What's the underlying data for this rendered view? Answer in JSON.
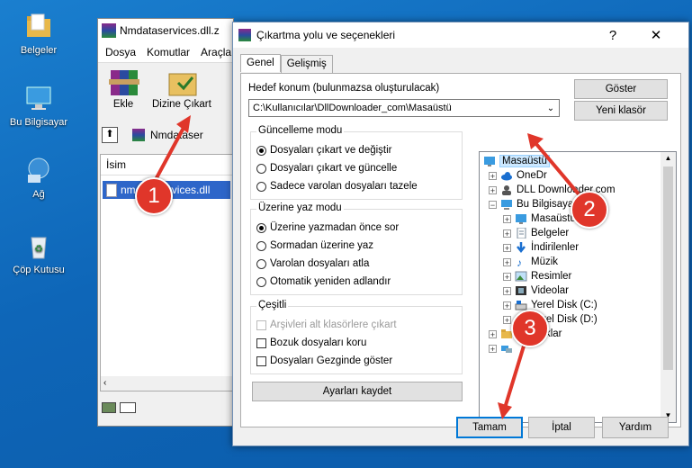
{
  "desktop": {
    "icons": [
      {
        "label": "Belgeler",
        "icon": "folder-icon"
      },
      {
        "label": "Bu Bilgisayar",
        "icon": "computer-icon"
      },
      {
        "label": "Ağ",
        "icon": "network-icon"
      },
      {
        "label": "Çöp Kutusu",
        "icon": "recycle-bin-icon"
      }
    ]
  },
  "winrar": {
    "title": "Nmdataservices.dll.z",
    "menu": [
      "Dosya",
      "Komutlar",
      "Araçla"
    ],
    "toolbar": {
      "add_label": "Ekle",
      "extract_label": "Dizine Çıkart"
    },
    "address_text": "Nmdataser",
    "column_name": "İsim",
    "selected_file": "nmdataservices.dll"
  },
  "dialog": {
    "title": "Çıkartma yolu ve seçenekleri",
    "help_glyph": "?",
    "close_glyph": "✕",
    "tabs": [
      "Genel",
      "Gelişmiş"
    ],
    "dest_label": "Hedef konum (bulunmazsa oluşturulacak)",
    "dest_value": "C:\\Kullanıcılar\\DllDownloader_com\\Masaüstü",
    "show_button": "Göster",
    "new_folder_button": "Yeni klasör",
    "update_mode": {
      "caption": "Güncelleme modu",
      "options": [
        "Dosyaları çıkart ve değiştir",
        "Dosyaları çıkart ve güncelle",
        "Sadece varolan dosyaları tazele"
      ],
      "selected": 0
    },
    "overwrite_mode": {
      "caption": "Üzerine yaz modu",
      "options": [
        "Üzerine yazmadan önce sor",
        "Sormadan üzerine yaz",
        "Varolan dosyaları atla",
        "Otomatik yeniden adlandır"
      ],
      "selected": 0
    },
    "misc": {
      "caption": "Çeşitli",
      "options": [
        "Arşivleri alt klasörlere çıkart",
        "Bozuk dosyaları koru",
        "Dosyaları Gezginde göster"
      ]
    },
    "save_settings_button": "Ayarları kaydet",
    "tree": [
      {
        "label": "Masaüstü",
        "selected": true
      },
      {
        "label": "OneDr"
      },
      {
        "label": "DLL Downloader.com"
      },
      {
        "label": "Bu Bilgisayar"
      },
      {
        "label": "Masaüstü"
      },
      {
        "label": "Belgeler"
      },
      {
        "label": "İndirilenler"
      },
      {
        "label": "Müzik"
      },
      {
        "label": "Resimler"
      },
      {
        "label": "Videolar"
      },
      {
        "label": "Yerel Disk (C:)"
      },
      {
        "label": "Yerel Disk (D:)"
      },
      {
        "label": "Kitaplıklar"
      },
      {
        "label": ""
      }
    ],
    "ok_button": "Tamam",
    "cancel_button": "İptal",
    "help_button": "Yardım"
  },
  "annotations": [
    "1",
    "2",
    "3"
  ],
  "colors": {
    "accent": "#0078d7",
    "badge": "#e0362a",
    "selection": "#2e66c9"
  }
}
